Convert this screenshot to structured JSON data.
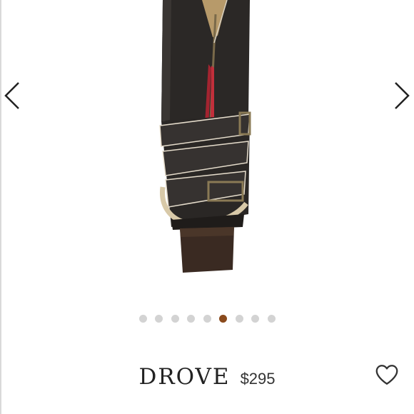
{
  "product": {
    "name": "DROVE",
    "price": "$295"
  },
  "carousel": {
    "slide_count": 9,
    "active_index": 5,
    "active_color": "#8a4a1c",
    "inactive_color": "#d3d3d3"
  },
  "icons": {
    "prev": "chevron-left-icon",
    "next": "chevron-right-icon",
    "favorite": "heart-outline-icon"
  }
}
